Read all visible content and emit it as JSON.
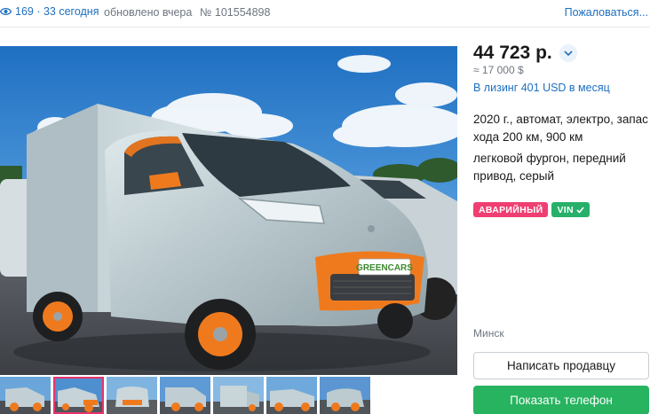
{
  "meta": {
    "views_label": "169 · 33 сегодня",
    "updated": "обновлено вчера",
    "listing_id": "№ 101554898",
    "report": "Пожаловаться..."
  },
  "gallery": {
    "main_image": "electric-van-photo",
    "brand_plate": "GREENCARS",
    "thumbnail_count": 7,
    "active_thumbnail": 1
  },
  "offer": {
    "price": "44 723 р.",
    "price_usd": "≈ 17 000 $",
    "leasing": "В лизинг 401 USD в месяц",
    "specs": "2020 г., автомат, электро, запас хода 200 км, 900 км",
    "body": "легковой фургон, передний привод, серый",
    "badge_damaged": "АВАРИЙНЫЙ",
    "badge_vin": "VIN",
    "city": "Минск",
    "write_button": "Написать продавцу",
    "phone_button": "Показать телефон"
  },
  "colors": {
    "link": "#1e6fbf",
    "damaged": "#ef3f72",
    "vin": "#26b06a",
    "phone_button": "#27b35f",
    "active_thumb": "#e8336b"
  }
}
